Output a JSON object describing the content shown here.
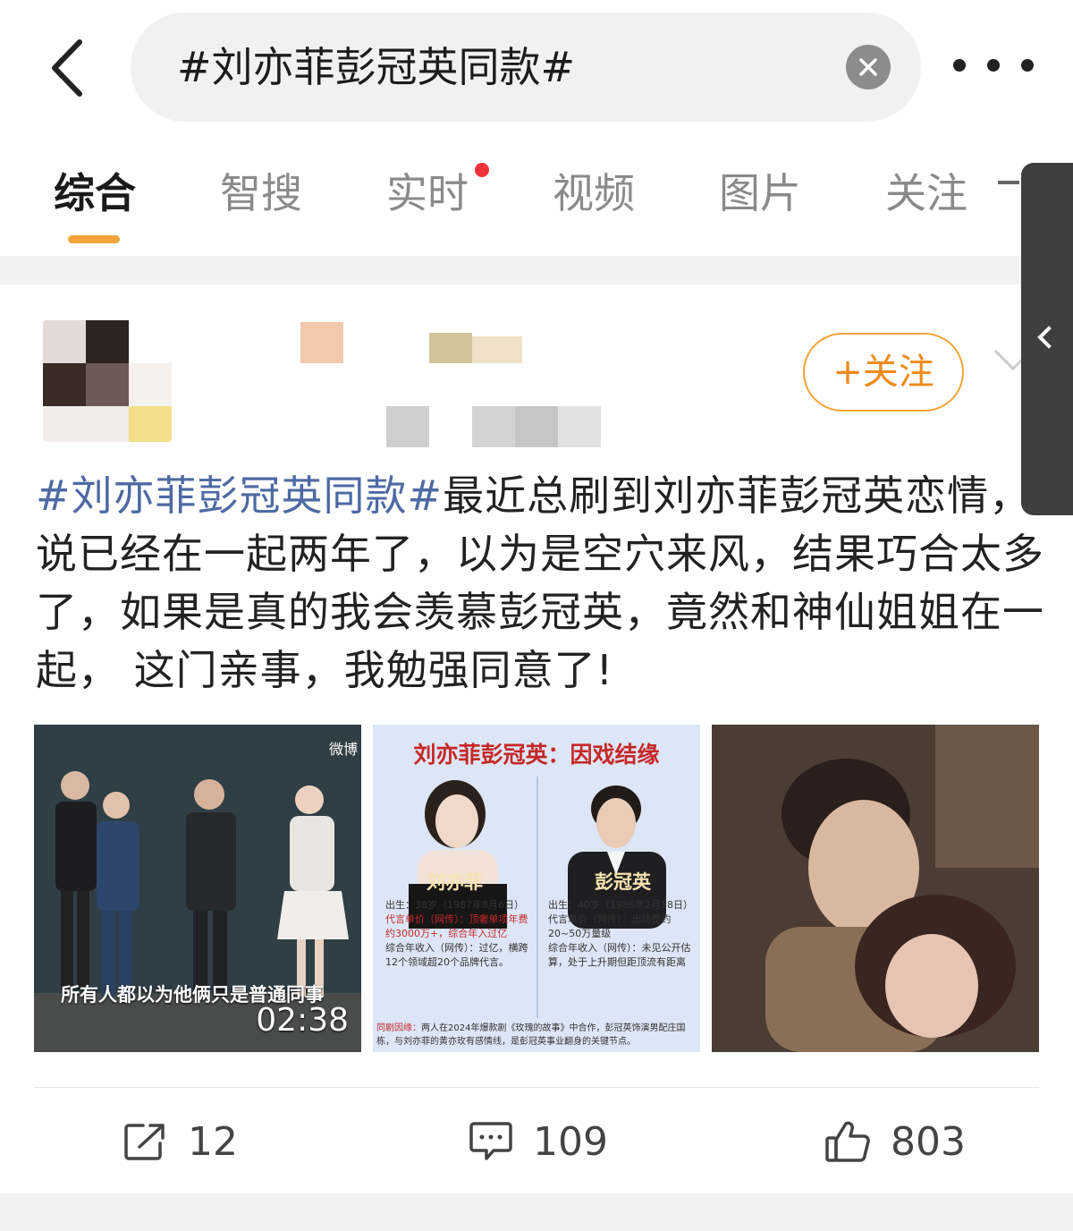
{
  "search": {
    "query": "#刘亦菲彭冠英同款#"
  },
  "tabs": [
    {
      "label": "综合",
      "active": true
    },
    {
      "label": "智搜",
      "active": false
    },
    {
      "label": "实时",
      "active": false,
      "has_dot": true
    },
    {
      "label": "视频",
      "active": false
    },
    {
      "label": "图片",
      "active": false
    },
    {
      "label": "关注",
      "active": false
    }
  ],
  "post": {
    "follow_label": "+关注",
    "hashtag": "#刘亦菲彭冠英同款#",
    "body": "最近总刷到刘亦菲彭冠英恋情，说已经在一起两年了，以为是空穴来风，结果巧合太多了，如果是真的我会羡慕彭冠英，竟然和神仙姐姐在一起， 这门亲事，我勉强同意了!",
    "video": {
      "caption": "所有人都以为他俩只是普通同事",
      "duration": "02:38",
      "watermark": "微博"
    },
    "poster": {
      "title": "刘亦菲彭冠英：因戏结缘",
      "left_name": "刘亦菲",
      "left_info": [
        "出生：38岁（1987年8月6日）",
        "代言单价（网传）：顶奢单项年费约3000万+，综合年入过亿",
        "综合年收入（网传）：过亿，横跨12个领域超20个品牌代言。"
      ],
      "right_name": "彭冠英",
      "right_info": [
        "出生：40岁（1986年2月18日）",
        "代言单价（网传）：出场费约20~50万量级",
        "综合年收入（网传）：未见公开估算，处于上升期但距顶流有距离"
      ],
      "footer_label": "同剧因缘：",
      "footer_text": "两人在2024年爆款剧《玫瑰的故事》中合作，彭冠英饰演男配庄国栋，与刘亦菲的黄亦玫有感情线，是彭冠英事业翻身的关键节点。"
    }
  },
  "actions": {
    "repost": "12",
    "comment": "109",
    "like": "803"
  },
  "colors": {
    "accent": "#f2a43a",
    "hashtag": "#4d6aa3",
    "dot": "#f2323b"
  }
}
